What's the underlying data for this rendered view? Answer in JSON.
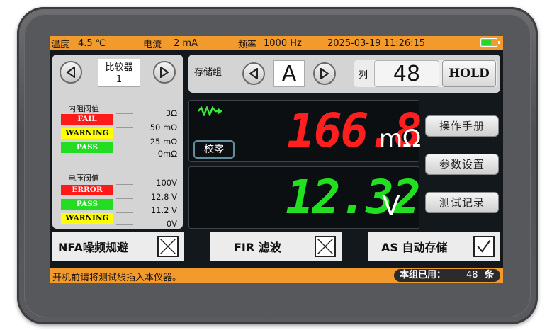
{
  "status": {
    "temperature_label": "温度",
    "temperature_value": "4.5 ℃",
    "current_label": "电流",
    "current_value": "2 mA",
    "frequency_label": "频率",
    "frequency_value": "1000 Hz",
    "datetime": "2025-03-19  11:26:15",
    "icons": [
      "bluetooth-icon",
      "usb-icon",
      "battery-icon"
    ],
    "battery_level": 0.6
  },
  "comparator": {
    "label": "比较器",
    "value": "1"
  },
  "resistance_threshold": {
    "title": "内阻阀值",
    "tags": [
      {
        "label": "FAIL",
        "bg": "#ff1a1a",
        "fg": "#ffffff"
      },
      {
        "label": "WARNING",
        "bg": "#ffff00",
        "fg": "#111111"
      },
      {
        "label": "PASS",
        "bg": "#22dd22",
        "fg": "#ffffff"
      }
    ],
    "values": [
      "3Ω",
      "50  mΩ",
      "25  mΩ",
      "0mΩ"
    ]
  },
  "voltage_threshold": {
    "title": "电压阀值",
    "tags": [
      {
        "label": "ERROR",
        "bg": "#ff1a1a",
        "fg": "#ffffff"
      },
      {
        "label": "PASS",
        "bg": "#22dd22",
        "fg": "#ffffff"
      },
      {
        "label": "WARNING",
        "bg": "#ffff00",
        "fg": "#111111"
      }
    ],
    "values": [
      "100V",
      "12.8  V",
      "11.2  V",
      "0V"
    ]
  },
  "storage_group": {
    "label": "存储组",
    "value": "A"
  },
  "column": {
    "label": "列",
    "value": "48"
  },
  "hold_label": "HOLD",
  "measurement": {
    "zero_label": "校零",
    "resistance_value": "166.8",
    "resistance_unit": "mΩ",
    "resistance_color": "#ff1f1f",
    "voltage_value": "12.32",
    "voltage_unit": "V",
    "voltage_color": "#20e020",
    "indicator_color": "#3ee63e"
  },
  "side_buttons": [
    "操作手册",
    "参数设置",
    "测试记录"
  ],
  "options": [
    {
      "label": "NFA噪频规避",
      "checked": false
    },
    {
      "label": "FIR  滤波",
      "checked": false
    },
    {
      "label": "AS  自动存储",
      "checked": true
    }
  ],
  "footer": {
    "message": "开机前请将测试线插入本仪器。",
    "used_label": "本组已用：",
    "used_count": "48",
    "used_suffix": "条"
  }
}
